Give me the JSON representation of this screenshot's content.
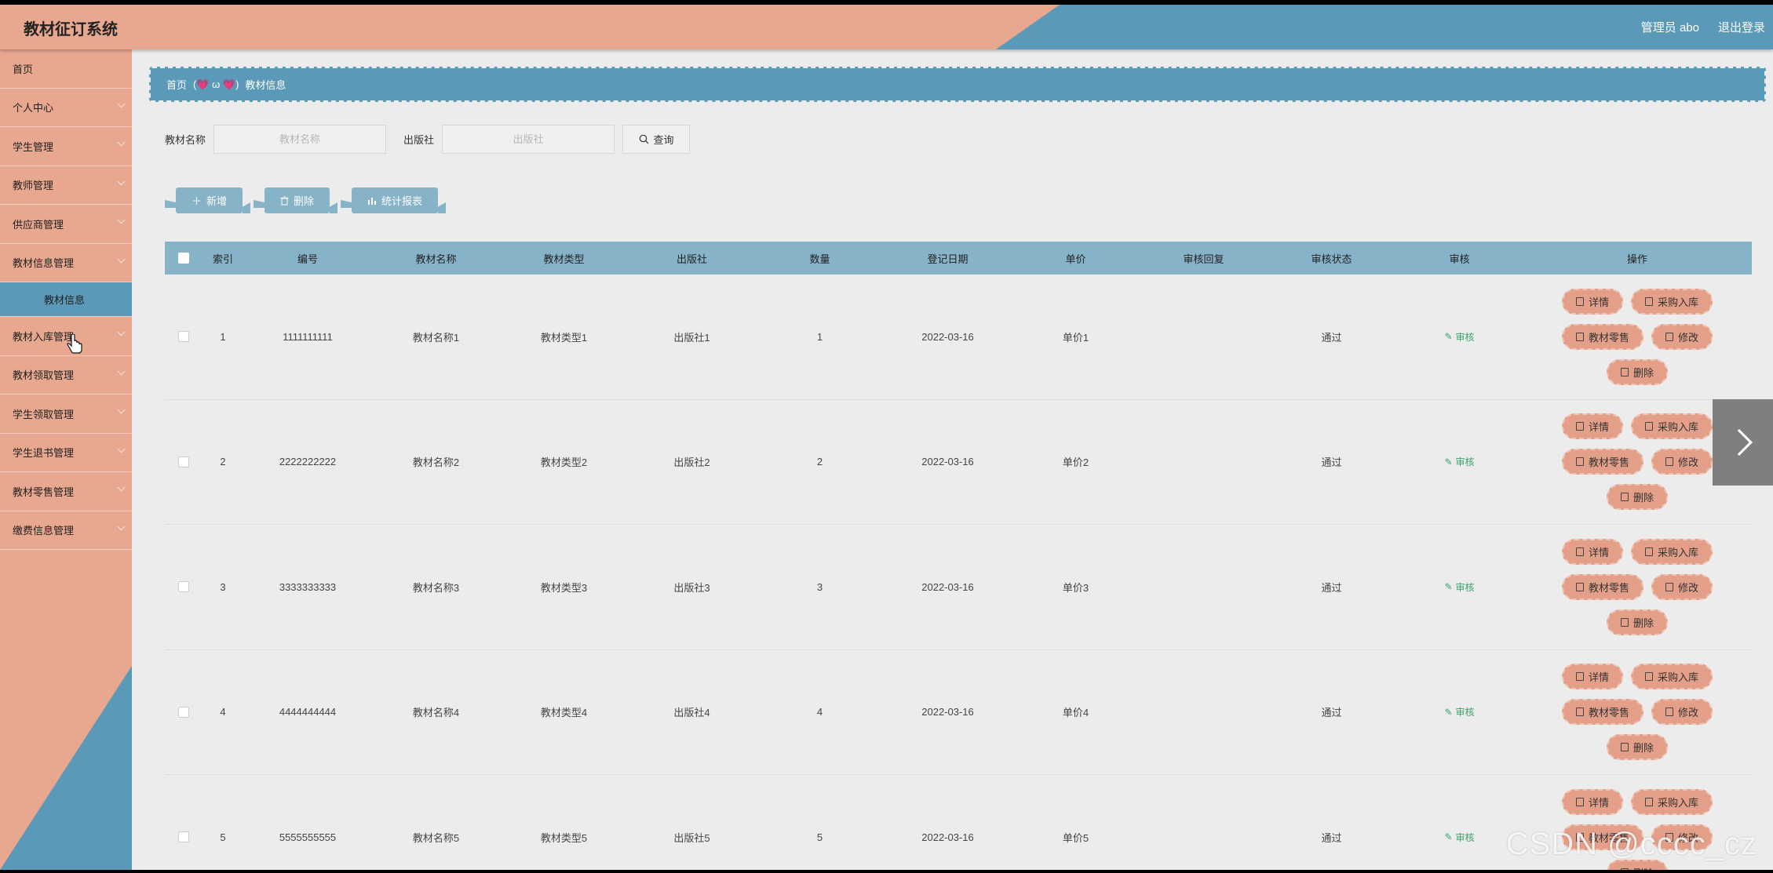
{
  "app": {
    "title": "教材征订系统"
  },
  "header": {
    "user": "管理员 abo",
    "logout": "退出登录"
  },
  "sidebar": {
    "items": [
      {
        "label": "首页",
        "chev": false
      },
      {
        "label": "个人中心",
        "chev": true
      },
      {
        "label": "学生管理",
        "chev": true
      },
      {
        "label": "教师管理",
        "chev": true
      },
      {
        "label": "供应商管理",
        "chev": true
      },
      {
        "label": "教材信息管理",
        "chev": true
      }
    ],
    "sub": "教材信息",
    "items2": [
      {
        "label": "教材入库管理"
      },
      {
        "label": "教材领取管理"
      },
      {
        "label": "学生领取管理"
      },
      {
        "label": "学生退书管理"
      },
      {
        "label": "教材零售管理"
      },
      {
        "label": "缴费信息管理"
      }
    ]
  },
  "breadcrumb": {
    "home": "首页",
    "sep": "(💗 ω 💗)",
    "current": "教材信息"
  },
  "search": {
    "name_label": "教材名称",
    "name_placeholder": "教材名称",
    "pub_label": "出版社",
    "pub_placeholder": "出版社",
    "query": "查询"
  },
  "actions": {
    "add": "新增",
    "delete": "删除",
    "report": "统计报表"
  },
  "table": {
    "headers": [
      "索引",
      "编号",
      "教材名称",
      "教材类型",
      "出版社",
      "数量",
      "登记日期",
      "单价",
      "审核回复",
      "审核状态",
      "审核",
      "操作"
    ],
    "rows": [
      {
        "idx": "1",
        "no": "1111111111",
        "name": "教材名称1",
        "type": "教材类型1",
        "pub": "出版社1",
        "qty": "1",
        "date": "2022-03-16",
        "price": "单价1",
        "reply": "",
        "status": "通过"
      },
      {
        "idx": "2",
        "no": "2222222222",
        "name": "教材名称2",
        "type": "教材类型2",
        "pub": "出版社2",
        "qty": "2",
        "date": "2022-03-16",
        "price": "单价2",
        "reply": "",
        "status": "通过"
      },
      {
        "idx": "3",
        "no": "3333333333",
        "name": "教材名称3",
        "type": "教材类型3",
        "pub": "出版社3",
        "qty": "3",
        "date": "2022-03-16",
        "price": "单价3",
        "reply": "",
        "status": "通过"
      },
      {
        "idx": "4",
        "no": "4444444444",
        "name": "教材名称4",
        "type": "教材类型4",
        "pub": "出版社4",
        "qty": "4",
        "date": "2022-03-16",
        "price": "单价4",
        "reply": "",
        "status": "通过"
      },
      {
        "idx": "5",
        "no": "5555555555",
        "name": "教材名称5",
        "type": "教材类型5",
        "pub": "出版社5",
        "qty": "5",
        "date": "2022-03-16",
        "price": "单价5",
        "reply": "",
        "status": "通过"
      }
    ],
    "audit_label": "审核",
    "ops": {
      "detail": "详情",
      "purchase": "采购入库",
      "retail": "教材零售",
      "edit": "修改",
      "delete": "删除"
    }
  },
  "watermark": "CSDN @cccc_cz",
  "colors": {
    "salmon": "#e8a78f",
    "teal": "#5a9ab8",
    "table_head": "#86b3c8",
    "op_button": "#e39f88"
  }
}
